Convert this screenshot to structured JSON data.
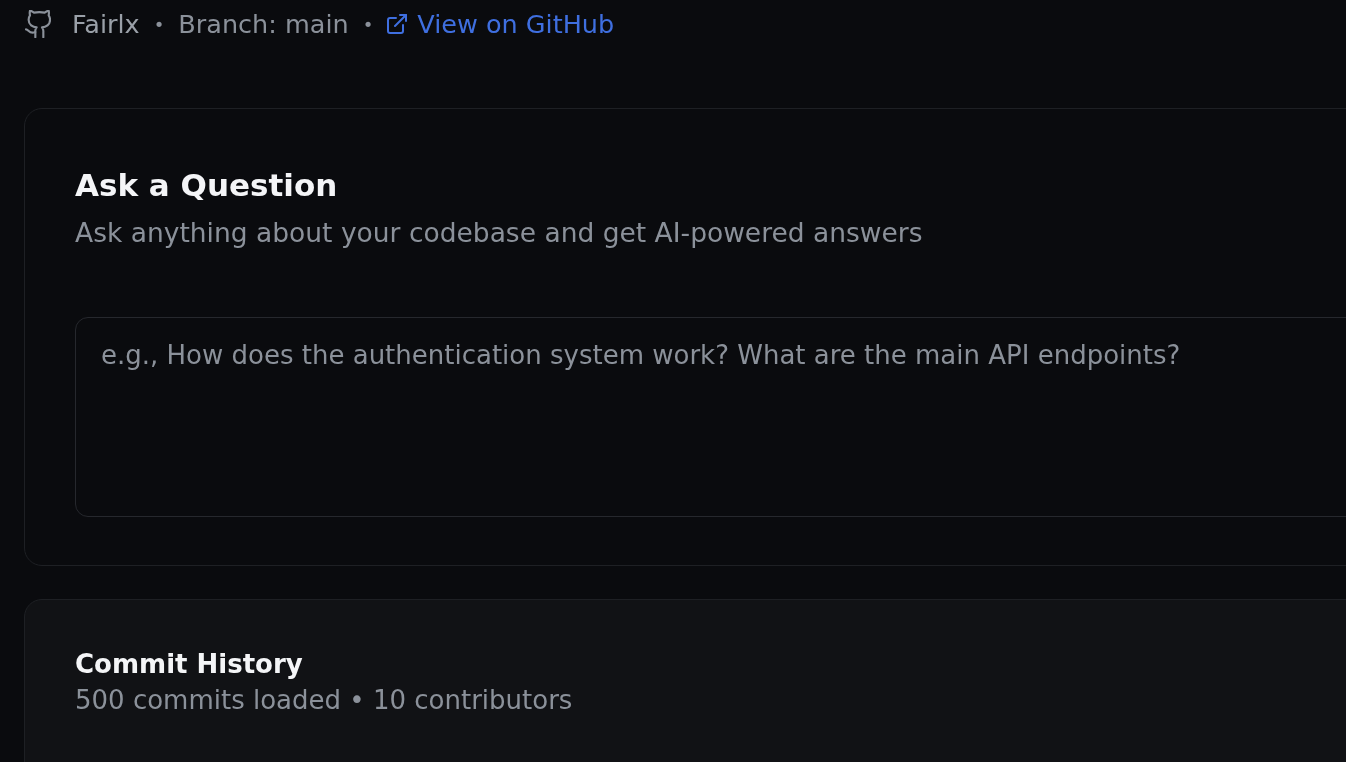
{
  "header": {
    "items": [
      {
        "kind": "repo",
        "text": "Fairlx"
      },
      {
        "kind": "separator",
        "text": "•"
      },
      {
        "kind": "text",
        "text": "Branch: main"
      },
      {
        "kind": "separator",
        "text": "•"
      },
      {
        "kind": "link",
        "text": "View on GitHub"
      }
    ]
  },
  "ask_panel": {
    "title": "Ask a Question",
    "subtitle": "Ask anything about your codebase and get AI-powered answers",
    "question": {
      "placeholder": "e.g., How does the authentication system work? What are the main API endpoints?"
    }
  },
  "commit_history": {
    "title": "Commit History",
    "subtitle": "500 commits loaded • 10 contributors"
  }
}
